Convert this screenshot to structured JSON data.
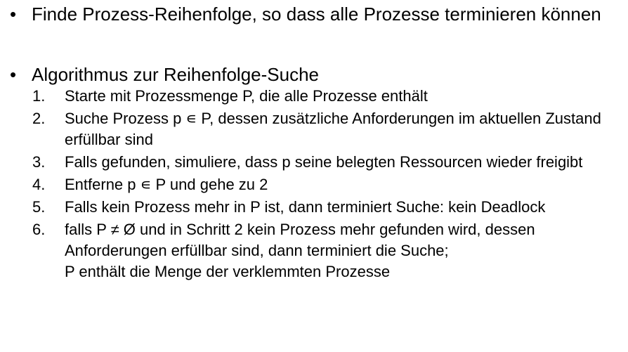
{
  "bullets": [
    {
      "glyph": "•",
      "text": "Finde Prozess-Reihenfolge, so dass alle Prozesse terminieren können"
    },
    {
      "glyph": "•",
      "text": "Algorithmus zur Reihenfolge-Suche"
    }
  ],
  "steps": [
    {
      "num": "1.",
      "text": "Starte mit Prozessmenge P, die alle Prozesse enthält"
    },
    {
      "num": "2.",
      "text": "Suche Prozess p ∊ P, dessen zusätzliche Anforderungen im aktuellen Zustand erfüllbar sind"
    },
    {
      "num": "3.",
      "text": "Falls gefunden, simuliere, dass p seine belegten Ressourcen wieder freigibt"
    },
    {
      "num": "4.",
      "text": "Entferne p ∊ P und gehe zu 2"
    },
    {
      "num": "5.",
      "text": "Falls kein Prozess mehr in P ist, dann terminiert Suche: kein Deadlock"
    },
    {
      "num": "6.",
      "text": "falls P ≠ Ø und in Schritt 2 kein Prozess mehr gefunden wird, dessen Anforderungen erfüllbar sind, dann terminiert die Suche;",
      "text2": "P enthält die Menge der verklemmten Prozesse"
    }
  ]
}
